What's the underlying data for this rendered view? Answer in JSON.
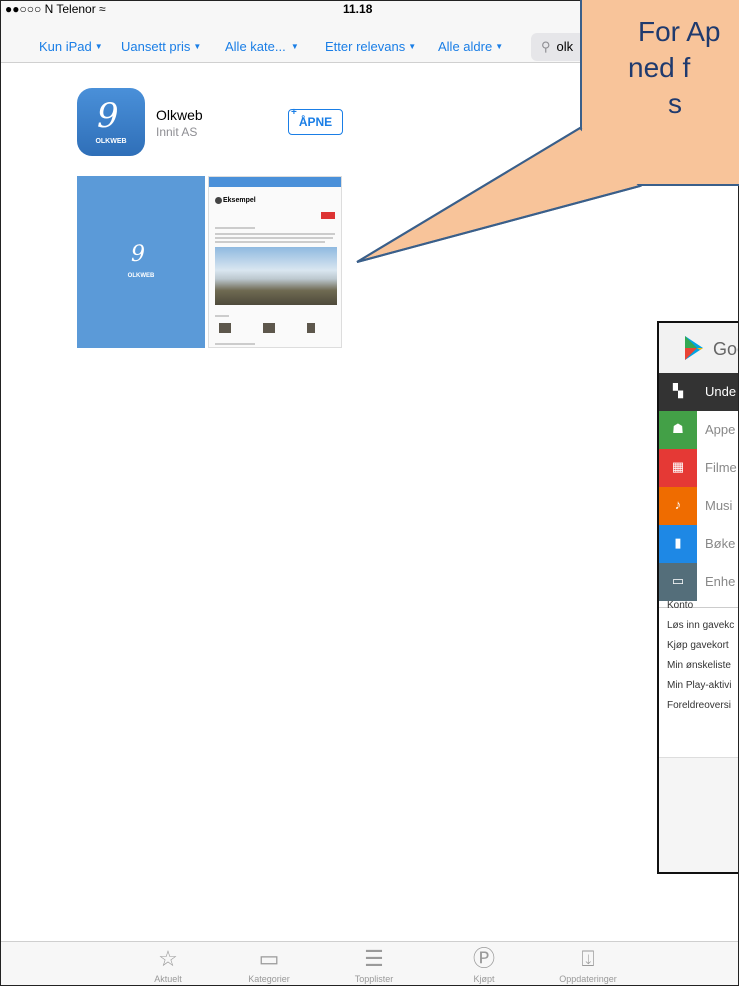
{
  "status_bar": {
    "carrier": "●●○○○ N Telenor ≈",
    "time": "11.18"
  },
  "filters": [
    "Kun iPad",
    "Uansett pris",
    "Alle kate...",
    "Etter relevans",
    "Alle aldre"
  ],
  "search": {
    "value": "olk"
  },
  "app": {
    "name": "Olkweb",
    "developer": "Innit AS",
    "icon_label": "OLKWEB",
    "open_label": "ÅPNE"
  },
  "screenshot2": {
    "title": "Eksempel"
  },
  "callout": {
    "lines": [
      "For Ap",
      "ned f",
      "s"
    ]
  },
  "google_play": {
    "brand": "Goo",
    "rows": [
      {
        "label": "Unde",
        "color": "#333333",
        "icon": "grid-icon"
      },
      {
        "label": "Appe",
        "color": "#43a047",
        "icon": "android-icon"
      },
      {
        "label": "Filme",
        "color": "#e53935",
        "icon": "film-icon"
      },
      {
        "label": "Musi",
        "color": "#ef6c00",
        "icon": "music-icon"
      },
      {
        "label": "Bøke",
        "color": "#1e88e5",
        "icon": "book-icon"
      },
      {
        "label": "Enhe",
        "color": "#546e7a",
        "icon": "device-icon"
      }
    ],
    "links": [
      "Konto",
      "Løs inn gavekc",
      "Kjøp gavekort",
      "Min ønskeliste",
      "Min Play-aktivi",
      "Foreldreoversi"
    ]
  },
  "tabbar": [
    {
      "label": "Aktuelt",
      "icon": "star-icon"
    },
    {
      "label": "Kategorier",
      "icon": "categories-icon"
    },
    {
      "label": "Topplister",
      "icon": "top-charts-icon"
    },
    {
      "label": "Kjøpt",
      "icon": "purchased-icon"
    },
    {
      "label": "Oppdateringer",
      "icon": "updates-icon"
    }
  ]
}
